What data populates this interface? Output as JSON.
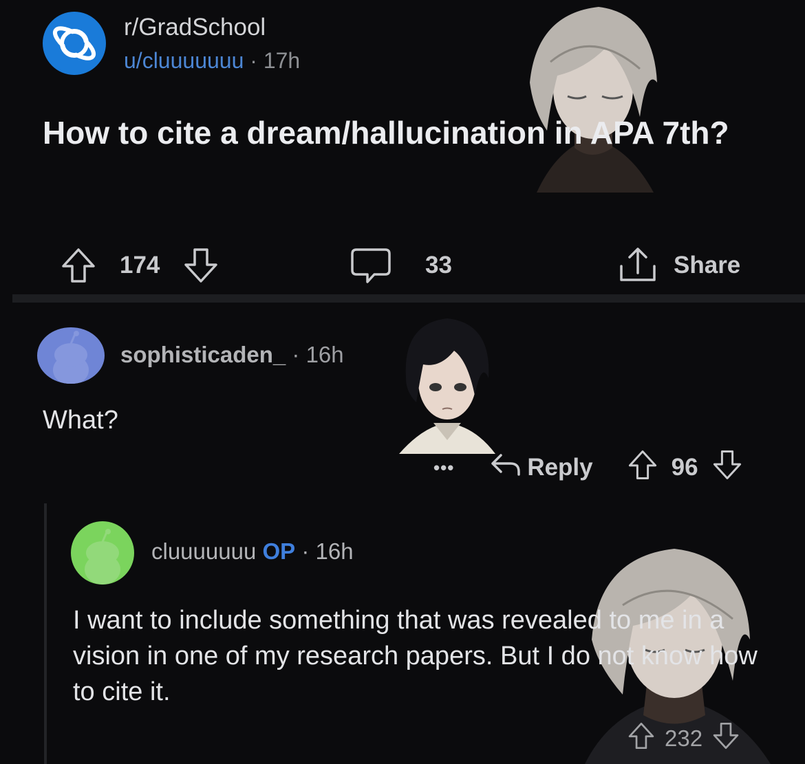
{
  "post": {
    "subreddit": "r/GradSchool",
    "author": "u/cluuuuuuu",
    "separator": "·",
    "age": "17h",
    "title": "How to cite a dream/hallucination in APA 7th?",
    "upvotes": "174",
    "comments": "33",
    "share_label": "Share",
    "subreddit_icon": "planet-icon"
  },
  "comments": [
    {
      "user": "sophisticaden_",
      "separator": "·",
      "age": "16h",
      "body": "What?",
      "more_label": "•••",
      "reply_label": "Reply",
      "votes": "96"
    },
    {
      "user": "cluuuuuuu",
      "op_badge": "OP",
      "separator": "·",
      "age": "16h",
      "body": "I want to include something that was revealed to me in a vision in one of my research papers. But I do not know how to cite it.",
      "votes": "232"
    }
  ],
  "colors": {
    "background": "#0b0b0d",
    "link_blue": "#4c86d4",
    "op_blue": "#3f7fdd",
    "subreddit_icon_bg": "#1a7bd9",
    "avatar_1": "#6f85d6",
    "avatar_2": "#7bd45d"
  }
}
